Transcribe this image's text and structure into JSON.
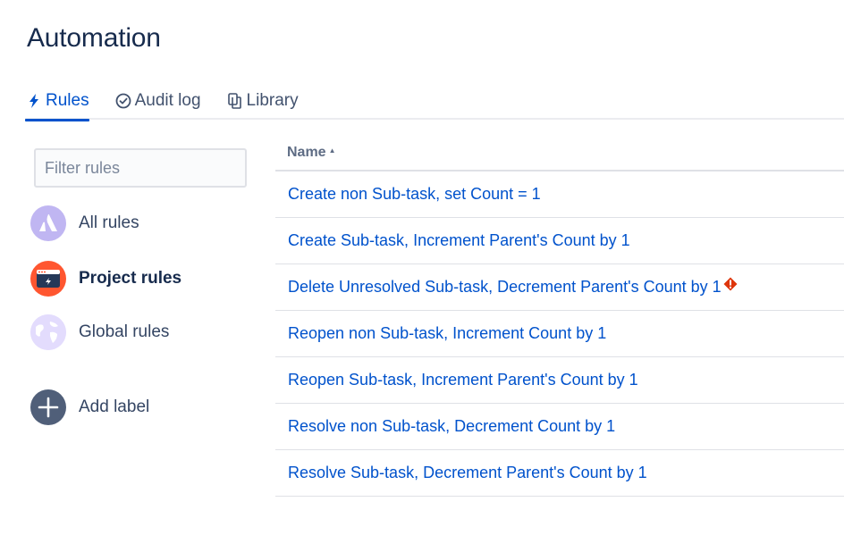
{
  "page": {
    "title": "Automation"
  },
  "tabs": [
    {
      "label": "Rules",
      "icon": "lightning-icon",
      "active": true
    },
    {
      "label": "Audit log",
      "icon": "check-circle-icon",
      "active": false
    },
    {
      "label": "Library",
      "icon": "copy-icon",
      "active": false
    }
  ],
  "sidebar": {
    "filter_placeholder": "Filter rules",
    "items": [
      {
        "label": "All rules",
        "icon": "atlassian-logo-icon"
      },
      {
        "label": "Project rules",
        "icon": "project-icon"
      },
      {
        "label": "Global rules",
        "icon": "globe-icon"
      }
    ],
    "add_label": "Add label"
  },
  "table": {
    "column_name": "Name",
    "rows": [
      {
        "name": "Create non Sub-task, set Count = 1"
      },
      {
        "name": "Create Sub-task, Increment Parent's Count by 1"
      },
      {
        "name": "Delete Unresolved Sub-task, Decrement Parent's Count by 1",
        "warning": true
      },
      {
        "name": "Reopen non Sub-task, Increment Count by 1"
      },
      {
        "name": "Reopen Sub-task, Increment Parent's Count by 1"
      },
      {
        "name": "Resolve non Sub-task, Decrement Count by 1"
      },
      {
        "name": "Resolve Sub-task, Decrement Parent's Count by 1"
      }
    ]
  },
  "colors": {
    "link": "#0052cc",
    "heading": "#172b4d",
    "warning": "#de350b",
    "project_avatar": "#ff5630",
    "all_rules_avatar": "#c0b6f2",
    "add_label_avatar": "#505f79"
  }
}
